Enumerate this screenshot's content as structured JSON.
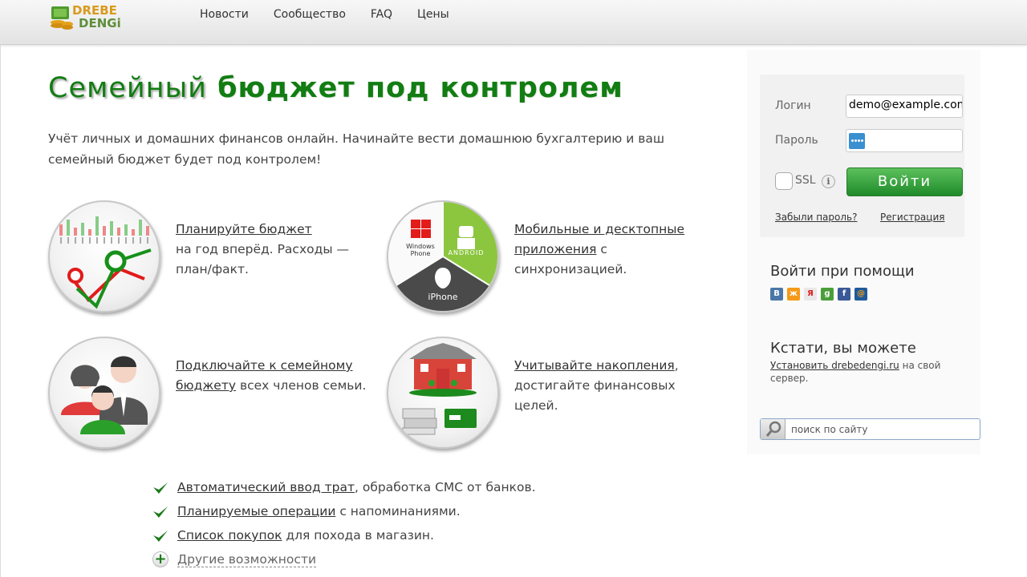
{
  "logo": {
    "line1": "DREBE",
    "line2": "DENGi"
  },
  "nav": [
    "Новости",
    "Сообщество",
    "FAQ",
    "Цены"
  ],
  "headline": {
    "bold": "Семейный",
    "rest": " бюджет под контролем"
  },
  "lead": "Учёт личных и домашних финансов онлайн. Начинайте вести домашнюю бухгалтерию и ваш семейный бюджет будет под контролем!",
  "features": [
    {
      "link": "Планируйте бюджет",
      "text": "на год вперёд. Расходы — план/факт.",
      "icon": "budget-chart-icon"
    },
    {
      "link": "Мобильные и десктопные приложения",
      "text": " с синхронизацией.",
      "icon": "mobile-platforms-icon",
      "labels": {
        "windows": "Windows Phone",
        "android": "ANDROID",
        "iphone": "iPhone"
      }
    },
    {
      "link": "Подключайте к семейному бюджету",
      "text": " всех членов семьи.",
      "icon": "family-icon"
    },
    {
      "link": "Учитывайте накопления",
      "text": ", достигайте финансовых целей.",
      "icon": "savings-house-icon"
    }
  ],
  "checks": [
    {
      "link": "Автоматический ввод трат",
      "text": ", обработка СМС от банков."
    },
    {
      "link": "Планируемые операции",
      "text": " с напоминаниями."
    },
    {
      "link": "Список покупок",
      "text": " для похода в магазин."
    }
  ],
  "more": "Другие возможности",
  "login": {
    "login_label": "Логин",
    "login_value": "demo@example.com",
    "password_label": "Пароль",
    "ssl_label": "SSL",
    "info": "i",
    "submit": "Войти",
    "forgot": "Забыли пароль?",
    "register": "Регистрация"
  },
  "social": {
    "title": "Войти при помощи",
    "items": [
      {
        "name": "vk",
        "glyph": "В",
        "color": "#4a76a8"
      },
      {
        "name": "odnoklassniki",
        "glyph": "ж",
        "color": "#f59a18"
      },
      {
        "name": "yandex",
        "glyph": "Я",
        "color": "#e8e8e8"
      },
      {
        "name": "google",
        "glyph": "g",
        "color": "#4a9e3a"
      },
      {
        "name": "facebook",
        "glyph": "f",
        "color": "#3b5998"
      },
      {
        "name": "mailru",
        "glyph": "@",
        "color": "#1f5a9a"
      }
    ]
  },
  "btw": {
    "title": "Кстати, вы можете",
    "link": "Установить drebedengi.ru",
    "text": " на свой сервер."
  },
  "search": {
    "placeholder": "поиск по сайту"
  },
  "colors": {
    "brand_green": "#127d12",
    "button_green": "#1f8a2a",
    "android_green": "#8cc63f"
  }
}
